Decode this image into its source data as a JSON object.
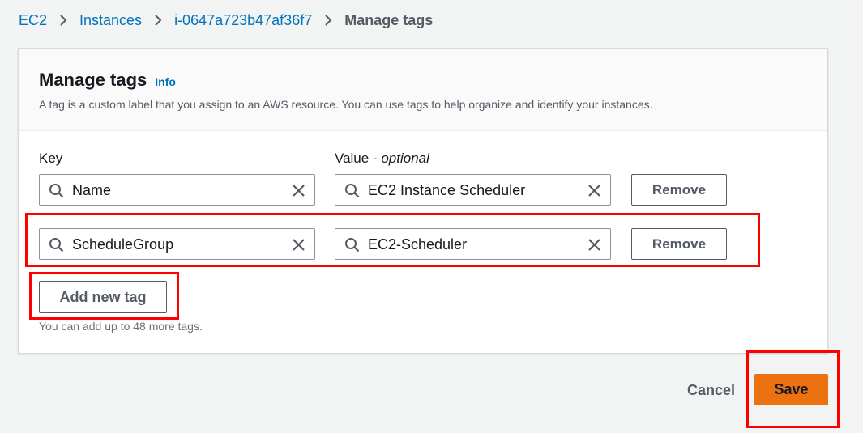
{
  "breadcrumb": {
    "items": [
      "EC2",
      "Instances",
      "i-0647a723b47af36f7"
    ],
    "current": "Manage tags"
  },
  "panel": {
    "title": "Manage tags",
    "info_link": "Info",
    "description": "A tag is a custom label that you assign to an AWS resource. You can use tags to help organize and identify your instances."
  },
  "columns": {
    "key_label": "Key",
    "value_label": "Value - ",
    "value_optional": "optional"
  },
  "tags": [
    {
      "key": "Name",
      "value": "EC2 Instance Scheduler",
      "remove_label": "Remove"
    },
    {
      "key": "ScheduleGroup",
      "value": "EC2-Scheduler",
      "remove_label": "Remove"
    }
  ],
  "add_tag_label": "Add new tag",
  "hint": "You can add up to 48 more tags.",
  "footer": {
    "cancel_label": "Cancel",
    "save_label": "Save"
  },
  "colors": {
    "link": "#0073bb",
    "primary_button": "#ec7211",
    "highlight": "#ff0000"
  },
  "icons": [
    "chevron-right-icon",
    "search-icon",
    "clear-icon"
  ]
}
